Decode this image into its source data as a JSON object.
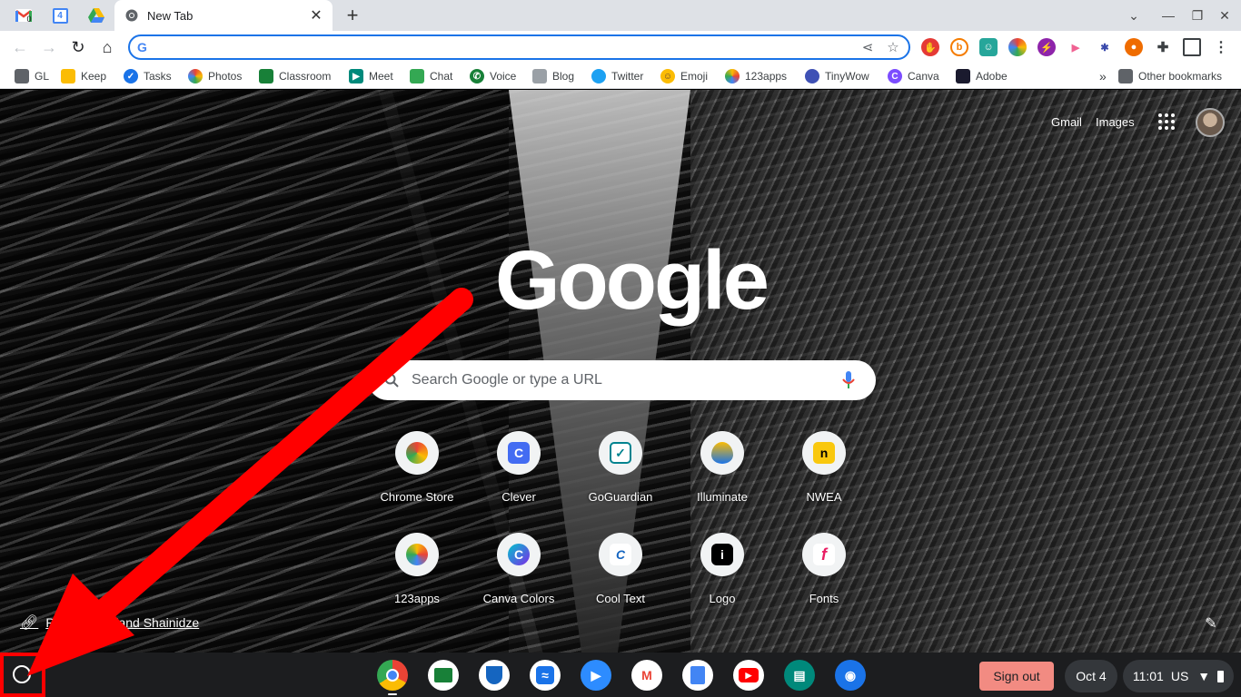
{
  "tabs": {
    "pinned": [
      {
        "name": "Gmail",
        "badge": "0"
      },
      {
        "name": "Google Calendar",
        "badge": "4"
      },
      {
        "name": "Google Drive"
      }
    ],
    "active_title": "New Tab"
  },
  "omnibox": {
    "value": ""
  },
  "bookmarks": {
    "items": [
      "GL",
      "Keep",
      "Tasks",
      "Photos",
      "Classroom",
      "Meet",
      "Chat",
      "Voice",
      "Blog",
      "Twitter",
      "Emoji",
      "123apps",
      "TinyWow",
      "Canva",
      "Adobe"
    ],
    "more": "»",
    "other": "Other bookmarks"
  },
  "ntp": {
    "gmail": "Gmail",
    "images": "Images",
    "logo": "Google",
    "search_placeholder": "Search Google or type a URL",
    "shortcuts": [
      "Chrome Store",
      "Clever",
      "GoGuardian",
      "Illuminate",
      "NWEA",
      "123apps",
      "Canva Colors",
      "Cool Text",
      "Logo",
      "Fonts"
    ],
    "credit": "Photo by Roland Shainidze"
  },
  "shelf": {
    "apps": [
      "Chrome",
      "Google Classroom",
      "Security",
      "Sheets",
      "Zoom",
      "Gmail",
      "Docs",
      "YouTube",
      "Slides Add-on",
      "Camera"
    ],
    "sign_out": "Sign out",
    "date": "Oct 4",
    "time": "11:01",
    "locale": "US"
  },
  "colors": {
    "accent": "#1a73e8",
    "annotation": "#ff0000",
    "signout_bg": "#f28b82"
  }
}
